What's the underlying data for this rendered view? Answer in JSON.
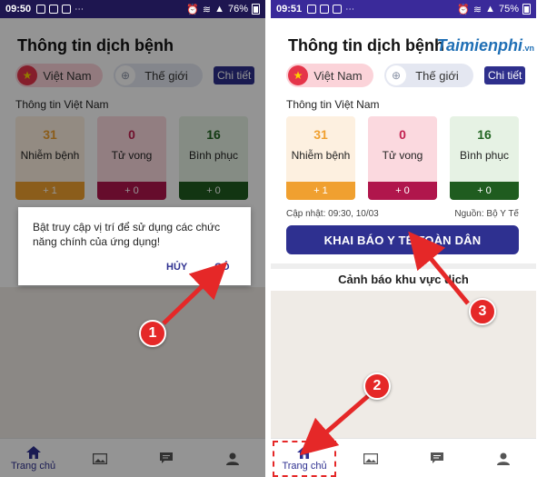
{
  "left": {
    "status": {
      "time": "09:50",
      "battery": "76%"
    },
    "title": "Thông tin dịch bệnh",
    "tabs": {
      "vietnam": "Việt Nam",
      "world": "Thế giới",
      "detail": "Chi tiết"
    },
    "section": "Thông tin Việt Nam",
    "stats": [
      {
        "value": "31",
        "label": "Nhiễm bệnh",
        "delta": "+ 1"
      },
      {
        "value": "0",
        "label": "Tử vong",
        "delta": "+ 0"
      },
      {
        "value": "16",
        "label": "Bình phục",
        "delta": "+ 0"
      }
    ],
    "dialog": {
      "message": "Bật truy cập vị trí để sử dụng các chức năng chính của ứng dụng!",
      "cancel": "HỦY",
      "ok": "CÓ"
    },
    "nav": {
      "home": "Trang chủ"
    }
  },
  "right": {
    "status": {
      "time": "09:51",
      "battery": "75%"
    },
    "title": "Thông tin dịch bệnh",
    "tabs": {
      "vietnam": "Việt Nam",
      "world": "Thế giới",
      "detail": "Chi tiết"
    },
    "section": "Thông tin Việt Nam",
    "stats": [
      {
        "value": "31",
        "label": "Nhiễm bệnh",
        "delta": "+ 1"
      },
      {
        "value": "0",
        "label": "Tử vong",
        "delta": "+ 0"
      },
      {
        "value": "16",
        "label": "Bình phục",
        "delta": "+ 0"
      }
    ],
    "update": "Cập nhật: 09:30, 10/03",
    "source": "Nguồn: Bộ Y Tế",
    "declare_button": "KHAI BÁO Y TẾ TOÀN DÂN",
    "warning_title": "Cảnh báo khu vực dịch",
    "nav": {
      "home": "Trang chủ"
    }
  },
  "watermark": {
    "brand": "Taimienphi",
    "suffix": ".vn"
  },
  "markers": [
    "1",
    "2",
    "3"
  ],
  "colors": {
    "accent": "#2e3090",
    "marker": "#e52828"
  }
}
